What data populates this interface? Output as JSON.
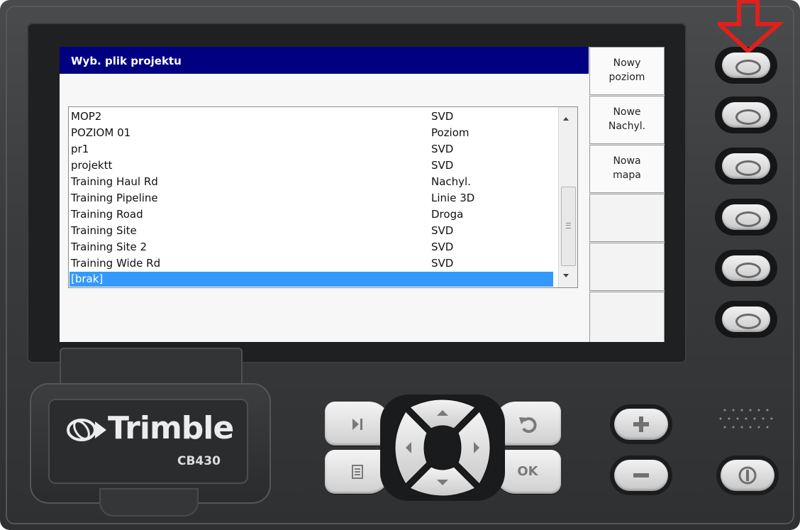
{
  "window": {
    "title": "Wyb. plik projektu"
  },
  "project_list": {
    "rows": [
      {
        "name": "MOP2",
        "type": "SVD"
      },
      {
        "name": "POZIOM 01",
        "type": "Poziom"
      },
      {
        "name": "pr1",
        "type": "SVD"
      },
      {
        "name": "projektt",
        "type": "SVD"
      },
      {
        "name": "Training Haul Rd",
        "type": "Nachyl."
      },
      {
        "name": "Training Pipeline",
        "type": "Linie 3D"
      },
      {
        "name": "Training Road",
        "type": "Droga"
      },
      {
        "name": "Training Site",
        "type": "SVD"
      },
      {
        "name": "Training Site 2",
        "type": "SVD"
      },
      {
        "name": "Training Wide Rd",
        "type": "SVD"
      },
      {
        "name": "[brak]",
        "type": ""
      }
    ],
    "selected_index": 10
  },
  "softkeys": [
    {
      "line1": "Nowy",
      "line2": "poziom"
    },
    {
      "line1": "Nowe",
      "line2": "Nachyl."
    },
    {
      "line1": "Nowa",
      "line2": "mapa"
    },
    {
      "line1": "",
      "line2": ""
    },
    {
      "line1": "",
      "line2": ""
    },
    {
      "line1": "",
      "line2": ""
    }
  ],
  "device": {
    "brand": "Trimble",
    "model": "CB430",
    "ok_label": "OK"
  },
  "colors": {
    "title_bar": "#000080",
    "selection": "#3399ff",
    "hint_arrow": "#e0201c"
  }
}
